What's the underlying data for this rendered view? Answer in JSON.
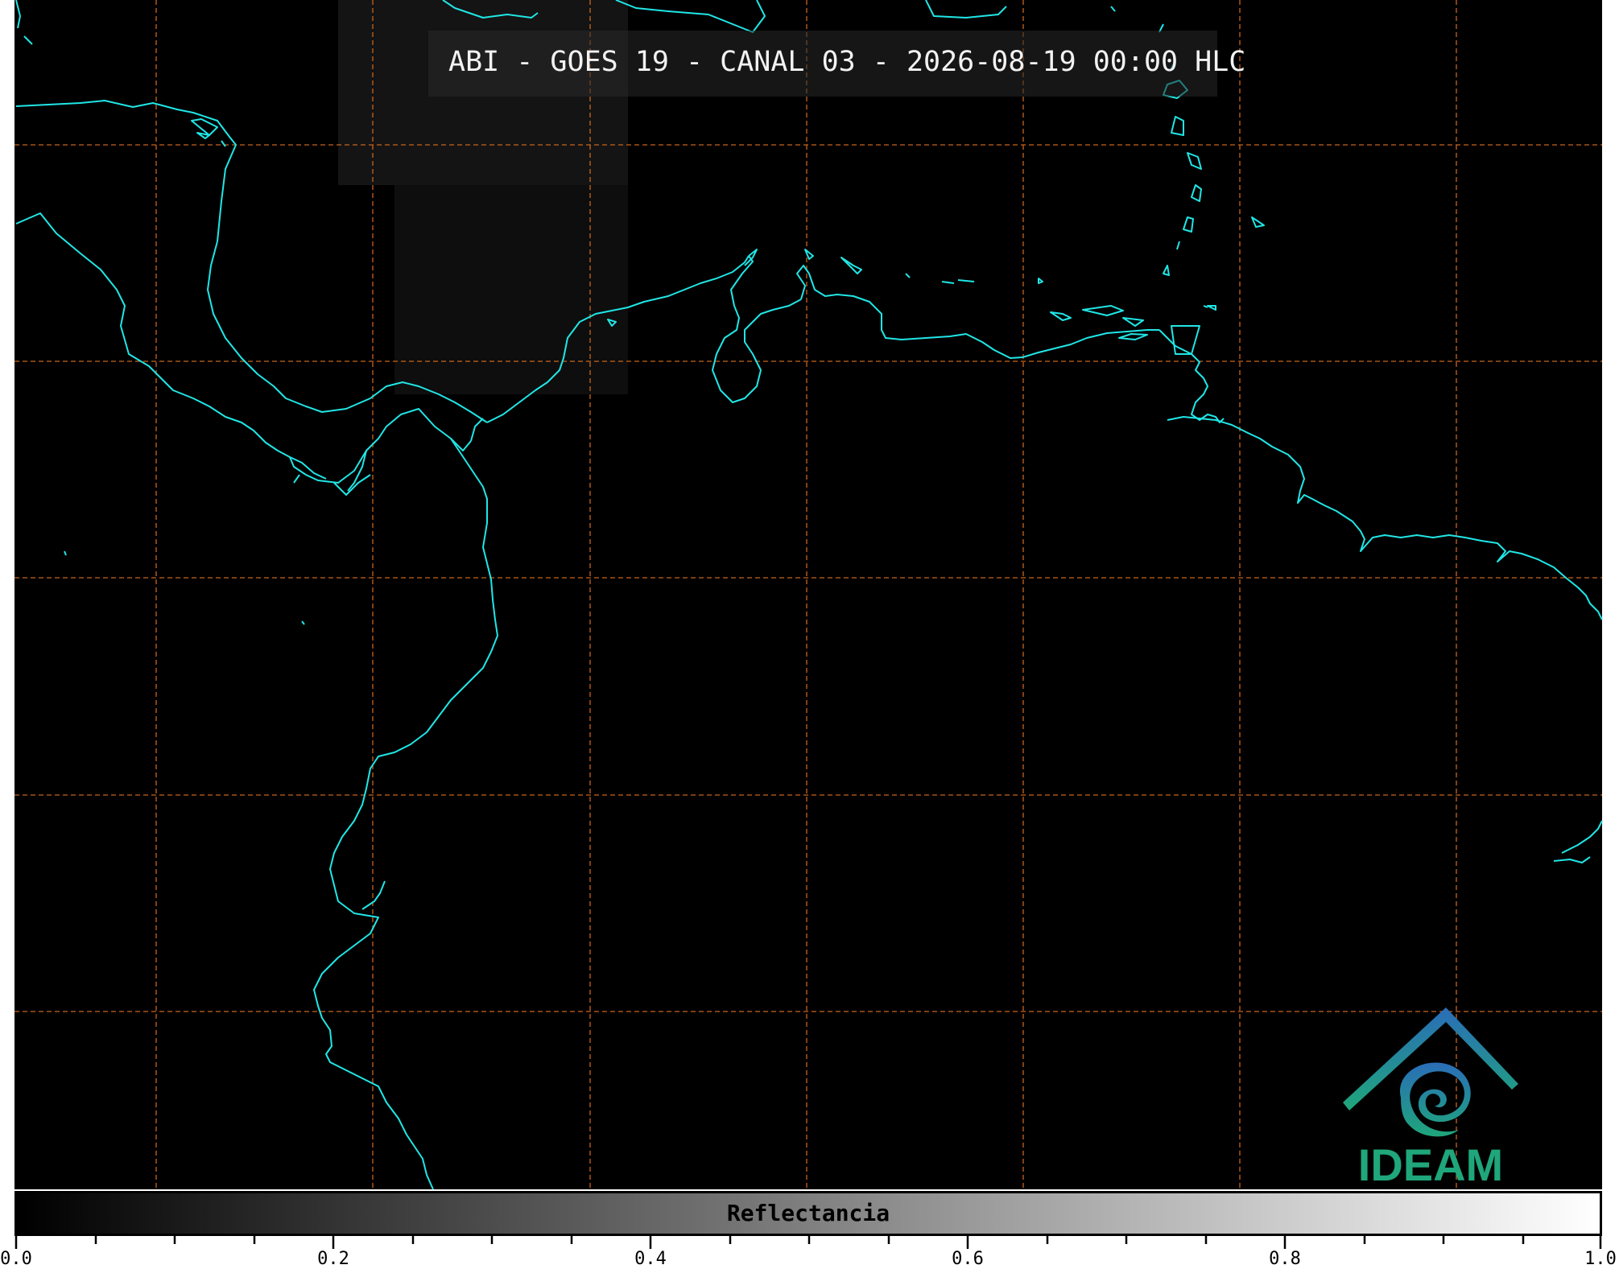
{
  "title": "ABI - GOES 19 - CANAL 03 - 2026-08-19 00:00 HLC",
  "colorbar": {
    "label": "Reflectancia",
    "ticks": [
      "0.0",
      "0.2",
      "0.4",
      "0.6",
      "0.8",
      "1.0"
    ],
    "min": 0.0,
    "max": 1.0
  },
  "logo": {
    "text": "IDEAM"
  },
  "colors": {
    "background": "#000000",
    "coastline": "#21e6e6",
    "gridlines": "#c8641e",
    "logo_blue": "#2a6db8",
    "logo_green": "#1fa67a"
  },
  "icons": [
    "ideam-logo-icon"
  ]
}
